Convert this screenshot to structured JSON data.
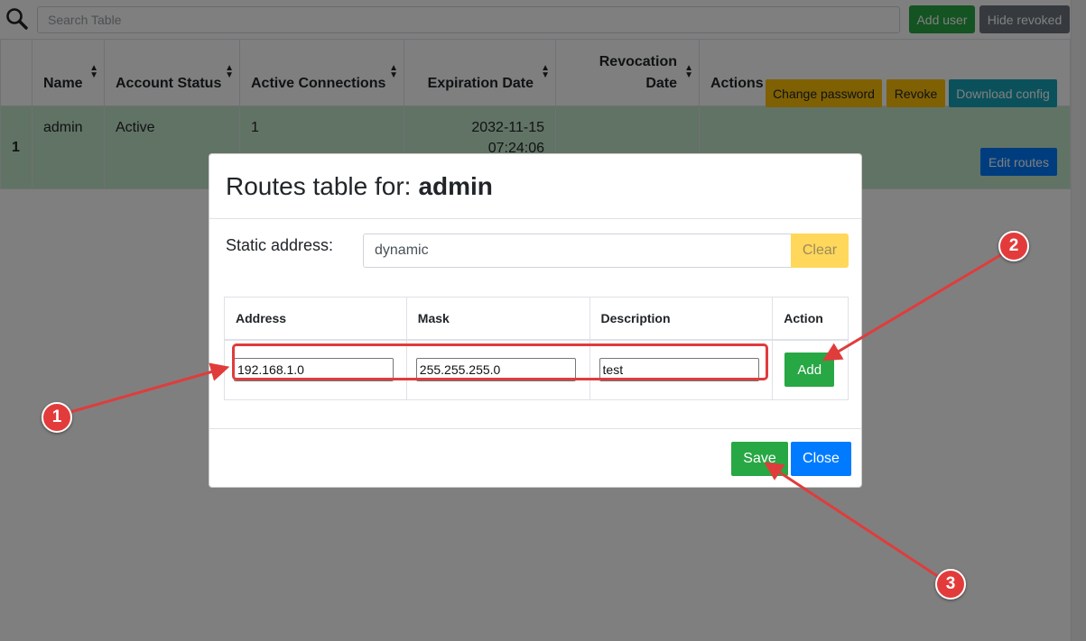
{
  "toolbar": {
    "search_placeholder": "Search Table",
    "add_user_label": "Add user",
    "hide_revoked_label": "Hide revoked"
  },
  "users_table": {
    "columns": [
      "",
      "Name",
      "Account Status",
      "Active Connections",
      "Expiration Date",
      "Revocation Date",
      "Actions"
    ],
    "rows": [
      {
        "index": "1",
        "name": "admin",
        "status": "Active",
        "connections": "1",
        "expiration": "2032-11-15 07:24:06",
        "revocation": ""
      }
    ],
    "actions": {
      "change_password": "Change password",
      "revoke": "Revoke",
      "download_config": "Download config",
      "edit_routes": "Edit routes"
    }
  },
  "modal": {
    "title_prefix": "Routes table for:",
    "title_user": "admin",
    "static_label": "Static address:",
    "static_value": "dynamic",
    "clear_label": "Clear",
    "routes_headers": [
      "Address",
      "Mask",
      "Description",
      "Action"
    ],
    "new_route": {
      "address": "192.168.1.0",
      "mask": "255.255.255.0",
      "description": "test"
    },
    "add_label": "Add",
    "save_label": "Save",
    "close_label": "Close"
  },
  "annotations": {
    "step1": "1",
    "step2": "2",
    "step3": "3",
    "color": "#e33b3b"
  },
  "colors": {
    "success": "#28a745",
    "secondary": "#6c757d",
    "warning": "#ffc107",
    "info": "#17a2b8",
    "primary": "#007bff",
    "row_active": "#c3e6cb"
  }
}
